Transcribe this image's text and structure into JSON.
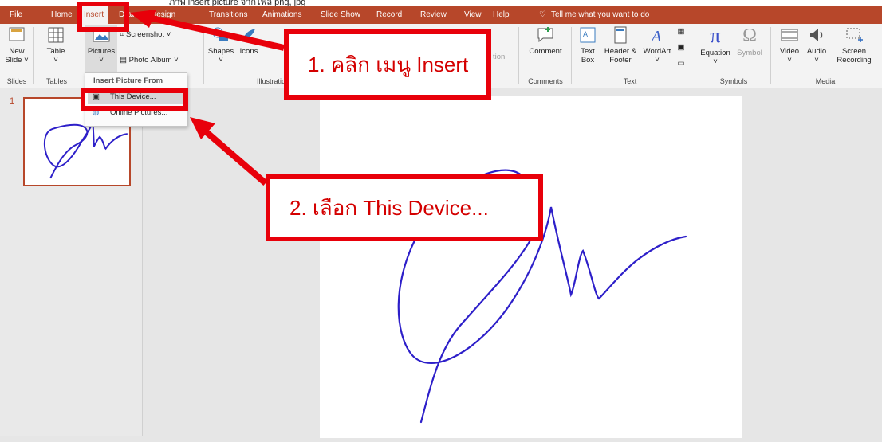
{
  "top_caption": "ภาพ insert picture จากไฟล์ png, jpg",
  "tabs": [
    "File",
    "Home",
    "Insert",
    "Draw",
    "Design",
    "Transitions",
    "Animations",
    "Slide Show",
    "Record",
    "Review",
    "View",
    "Help"
  ],
  "tell_me": "Tell me what you want to do",
  "ribbon": {
    "new_slide": "New Slide",
    "table": "Table",
    "pictures": "Pictures",
    "screenshot": "Screenshot",
    "photo_album": "Photo Album",
    "shapes": "Shapes",
    "icons": "Icons",
    "action_fragment": "tion",
    "comment": "Comment",
    "text_box": "Text Box",
    "header_footer": "Header & Footer",
    "wordart": "WordArt",
    "equation": "Equation",
    "symbol": "Symbol",
    "video": "Video",
    "audio": "Audio",
    "screen_recording": "Screen Recording",
    "groups": {
      "slides": "Slides",
      "tables": "Tables",
      "illustrations": "Illustratio",
      "comments": "Comments",
      "text": "Text",
      "symbols": "Symbols",
      "media": "Media"
    }
  },
  "dropdown": {
    "header": "Insert Picture From",
    "this_device": "This Device...",
    "online_pictures": "Online Pictures..."
  },
  "slide_panel": {
    "number": "1"
  },
  "callouts": {
    "step1": "1. คลิก เมนู Insert",
    "step2": "2. เลือก This Device..."
  },
  "colors": {
    "accent": "#b7472a",
    "annotation_red": "#e8000a",
    "signature_blue": "#2d1fc9"
  }
}
